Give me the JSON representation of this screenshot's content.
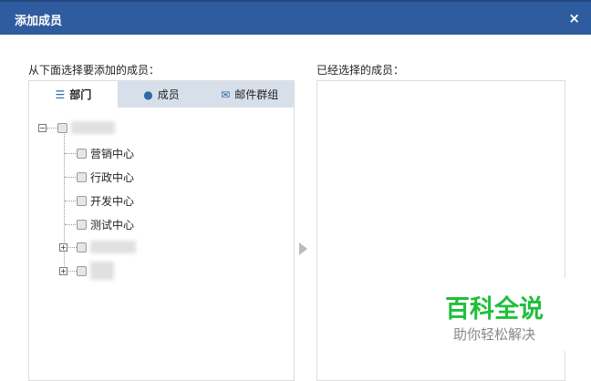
{
  "dialog": {
    "title": "添加成员",
    "close": "×"
  },
  "left": {
    "label": "从下面选择要添加的成员：",
    "tabs": [
      {
        "label": "部门",
        "icon": "list-icon"
      },
      {
        "label": "成员",
        "icon": "user-icon"
      },
      {
        "label": "邮件群组",
        "icon": "mail-group-icon"
      }
    ],
    "tree": {
      "children": [
        {
          "label": "营销中心"
        },
        {
          "label": "行政中心"
        },
        {
          "label": "开发中心"
        },
        {
          "label": "测试中心"
        }
      ]
    }
  },
  "right": {
    "label": "已经选择的成员："
  },
  "watermark": {
    "title": "百科全说",
    "subtitle": "助你轻松解决"
  }
}
